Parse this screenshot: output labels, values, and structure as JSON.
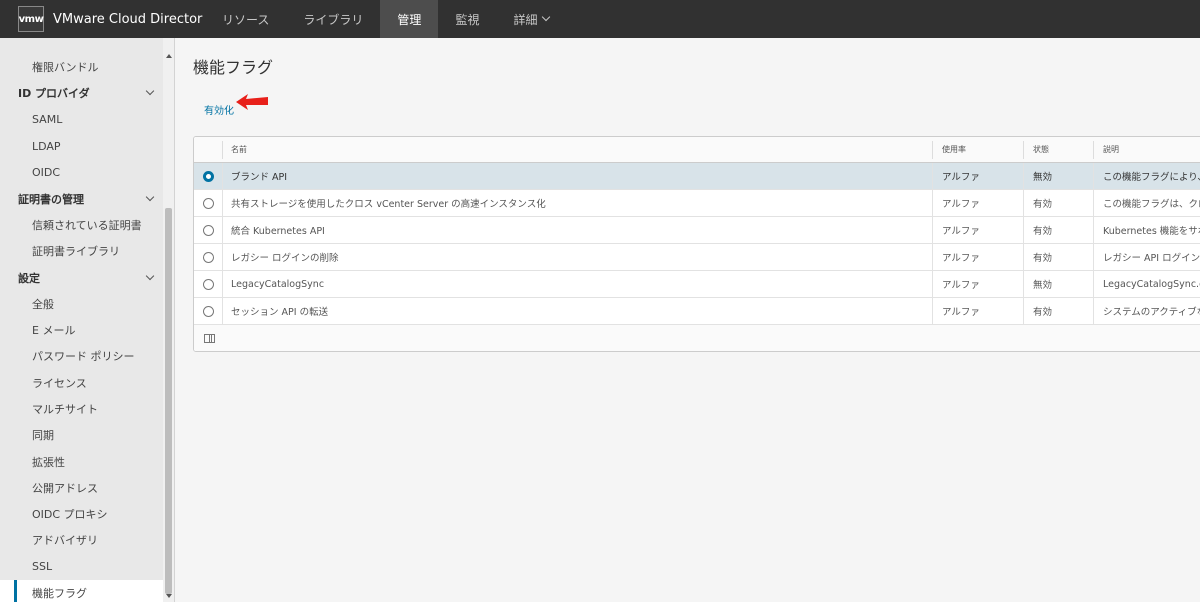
{
  "header": {
    "logo_text": "vmw",
    "app_title": "VMware Cloud Director",
    "nav": [
      {
        "label": "リソース"
      },
      {
        "label": "ライブラリ"
      },
      {
        "label": "管理"
      },
      {
        "label": "監視"
      },
      {
        "label": "詳細"
      }
    ],
    "active_nav": "管理"
  },
  "sidebar": {
    "items": [
      {
        "label": "権限バンドル",
        "type": "child"
      },
      {
        "label": "ID プロバイダ",
        "type": "group"
      },
      {
        "label": "SAML",
        "type": "child"
      },
      {
        "label": "LDAP",
        "type": "child"
      },
      {
        "label": "OIDC",
        "type": "child"
      },
      {
        "label": "証明書の管理",
        "type": "group"
      },
      {
        "label": "信頼されている証明書",
        "type": "child"
      },
      {
        "label": "証明書ライブラリ",
        "type": "child"
      },
      {
        "label": "設定",
        "type": "group"
      },
      {
        "label": "全般",
        "type": "child"
      },
      {
        "label": "E メール",
        "type": "child"
      },
      {
        "label": "パスワード ポリシー",
        "type": "child"
      },
      {
        "label": "ライセンス",
        "type": "child"
      },
      {
        "label": "マルチサイト",
        "type": "child"
      },
      {
        "label": "同期",
        "type": "child"
      },
      {
        "label": "拡張性",
        "type": "child"
      },
      {
        "label": "公開アドレス",
        "type": "child"
      },
      {
        "label": "OIDC プロキシ",
        "type": "child"
      },
      {
        "label": "アドバイザリ",
        "type": "child"
      },
      {
        "label": "SSL",
        "type": "child"
      },
      {
        "label": "機能フラグ",
        "type": "child",
        "active": true
      }
    ]
  },
  "main": {
    "title": "機能フラグ",
    "enable_link": "有効化",
    "columns": {
      "name": "名前",
      "usage": "使用率",
      "state": "状態",
      "desc": "説明"
    },
    "rows": [
      {
        "name": "ブランド API",
        "usage": "アルファ",
        "state": "無効",
        "desc": "この機能フラグにより、",
        "selected": true
      },
      {
        "name": "共有ストレージを使用したクロス vCenter Server の高速インスタンス化",
        "usage": "アルファ",
        "state": "有効",
        "desc": "この機能フラグは、クロ"
      },
      {
        "name": "統合 Kubernetes API",
        "usage": "アルファ",
        "state": "有効",
        "desc": "Kubernetes 機能をサポ"
      },
      {
        "name": "レガシー ログインの削除",
        "usage": "アルファ",
        "state": "有効",
        "desc": "レガシー API ログイン("
      },
      {
        "name": "LegacyCatalogSync",
        "usage": "アルファ",
        "state": "無効",
        "desc": "LegacyCatalogSync.de"
      },
      {
        "name": "セッション API の転送",
        "usage": "アルファ",
        "state": "有効",
        "desc": "システムのアクティブな"
      }
    ],
    "accent_color": "#0072a3",
    "annotation_arrow_color": "#e8201a"
  }
}
